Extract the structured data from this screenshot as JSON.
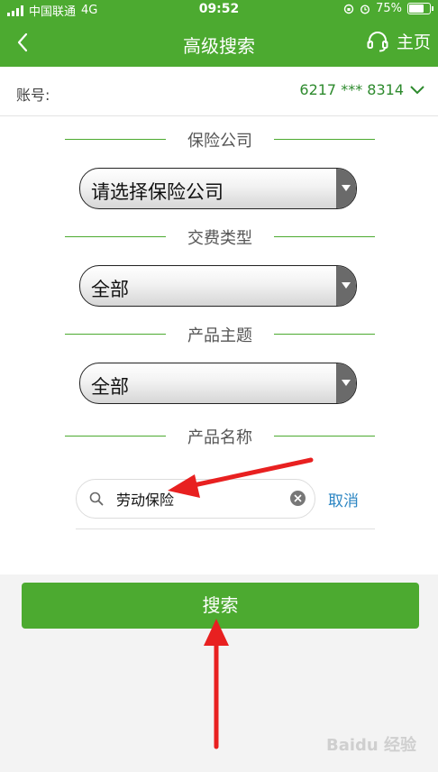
{
  "status_bar": {
    "carrier": "中国联通",
    "network": "4G",
    "time": "09:52",
    "battery": "75%"
  },
  "header": {
    "title": "高级搜索",
    "home_label": "主页"
  },
  "account": {
    "label": "账号:",
    "value": "6217 *** 8314"
  },
  "sections": {
    "insurance_company": {
      "title": "保险公司",
      "selected": "请选择保险公司"
    },
    "payment_type": {
      "title": "交费类型",
      "selected": "全部"
    },
    "product_theme": {
      "title": "产品主题",
      "selected": "全部"
    },
    "product_name": {
      "title": "产品名称",
      "input_value": "劳动保险",
      "cancel_label": "取消"
    }
  },
  "search_button": {
    "label": "搜索"
  },
  "colors": {
    "brand_green": "#4caa30",
    "account_value": "#2d8a2d",
    "link_blue": "#2c86c3",
    "annotation_red": "#e82020"
  },
  "watermark": "Baidu 经验"
}
